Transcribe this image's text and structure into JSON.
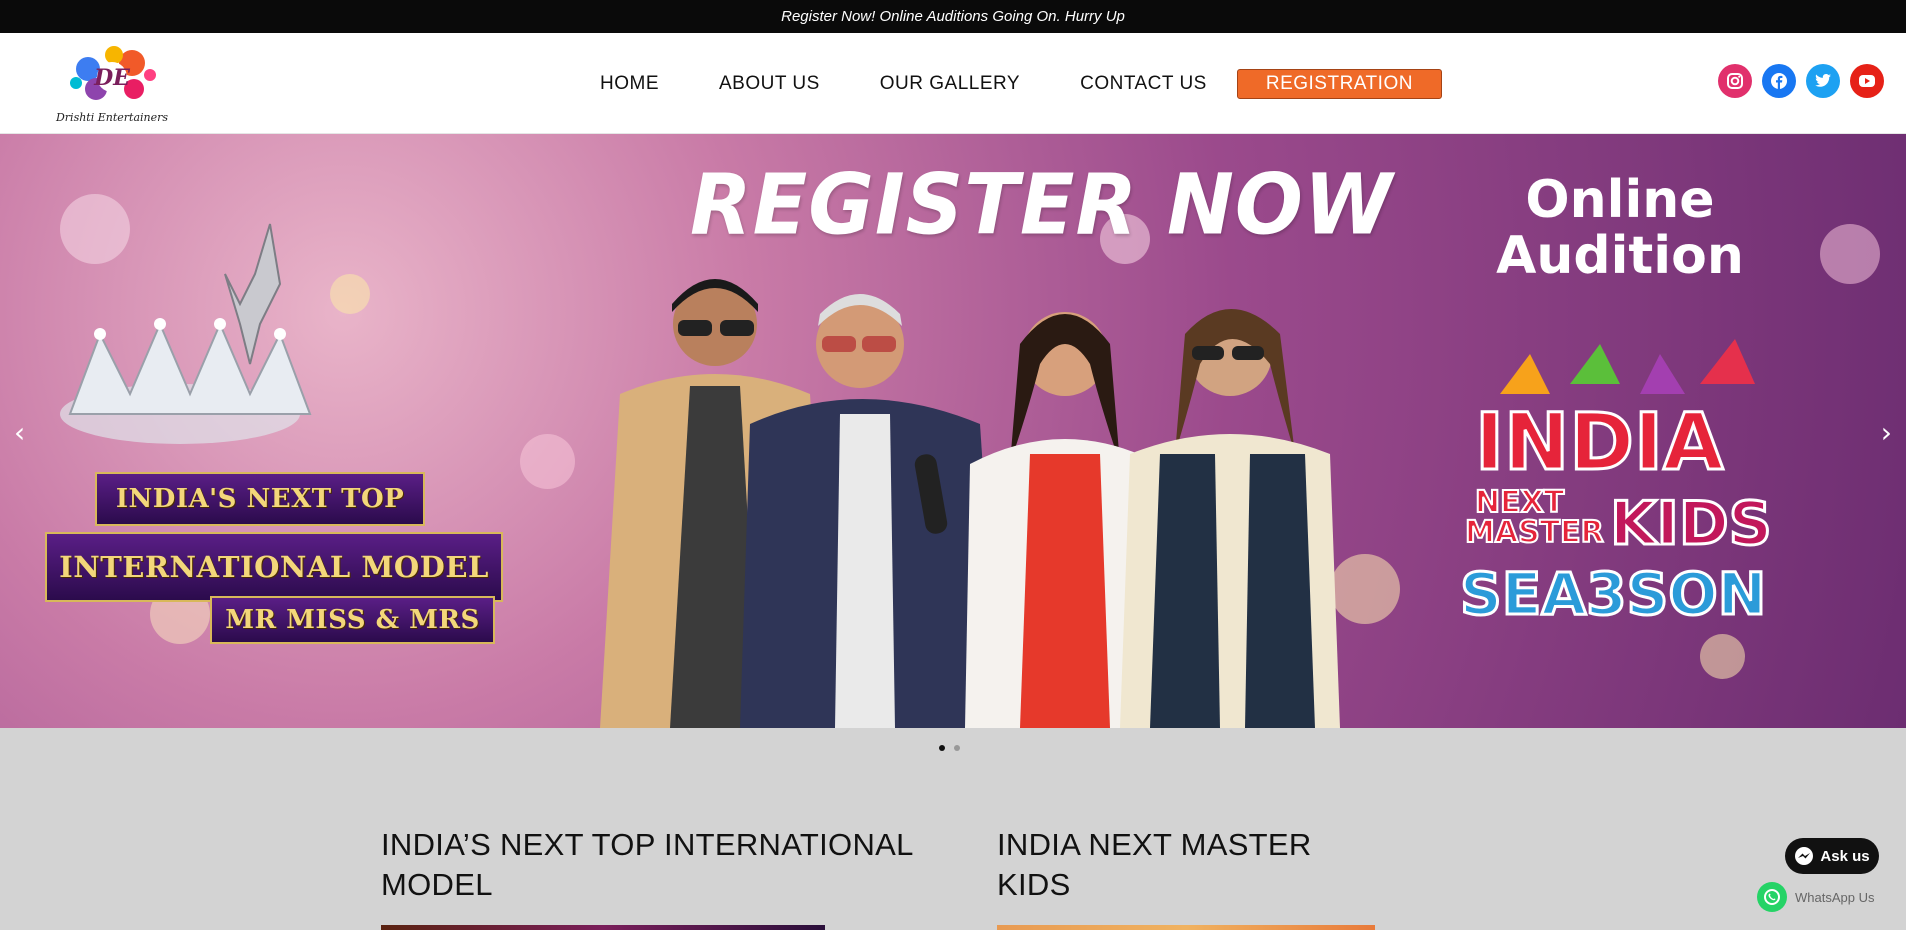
{
  "announcement": "Register Now! Online Auditions Going On. Hurry Up",
  "logo": {
    "text": "Drishti Entertainers",
    "mark": "DE"
  },
  "nav": {
    "items": [
      "HOME",
      "ABOUT US",
      "OUR GALLERY",
      "CONTACT US"
    ],
    "registration": "REGISTRATION"
  },
  "social": [
    {
      "name": "instagram-icon",
      "color": "#e1306c"
    },
    {
      "name": "facebook-icon",
      "color": "#1877f2"
    },
    {
      "name": "twitter-icon",
      "color": "#1da1f2"
    },
    {
      "name": "youtube-icon",
      "color": "#e62117"
    }
  ],
  "hero": {
    "title": "REGISTER NOW",
    "online_line1": "Online",
    "online_line2": "Audition",
    "banner_line1": "INDIA'S NEXT TOP",
    "banner_line2": "INTERNATIONAL MODEL",
    "banner_line3": "MR MISS & MRS",
    "kids_india": "INDIA",
    "kids_next": "NEXT",
    "kids_master": "MASTER",
    "kids_kids": "KIDS",
    "kids_season": "SEA3SON",
    "prev": "‹",
    "next": "›"
  },
  "slider": {
    "slides": 2,
    "active": 1
  },
  "cards": {
    "left_title_1": "INDIA’S NEXT TOP INTERNATIONAL",
    "left_title_2": "MODEL",
    "right_title_1": "INDIA NEXT MASTER",
    "right_title_2": "KIDS"
  },
  "chat": {
    "ask": "Ask us",
    "whatsapp": "WhatsApp Us"
  }
}
